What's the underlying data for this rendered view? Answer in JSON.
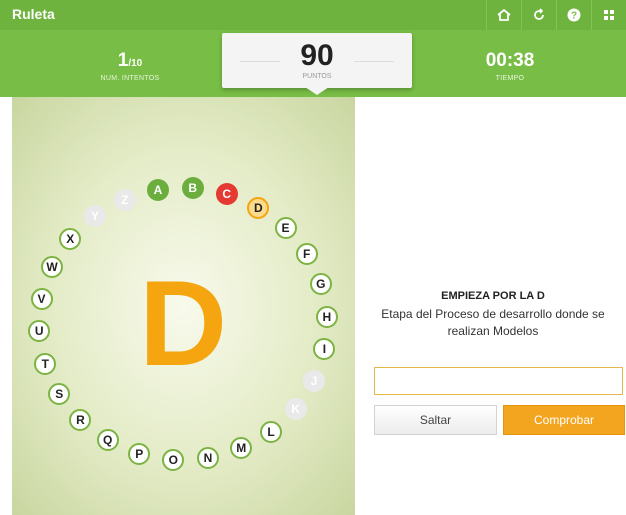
{
  "app": {
    "title": "Ruleta"
  },
  "toolbar": {
    "icons": [
      "home-icon",
      "restart-icon",
      "help-icon",
      "menu-icon"
    ]
  },
  "stats": {
    "attempts": {
      "value": "1",
      "total": "/10",
      "label": "NUM. INTENTOS"
    },
    "score": {
      "value": "90",
      "label": "PUNTOS"
    },
    "time": {
      "value": "00:38",
      "label": "TIEMPO"
    }
  },
  "game": {
    "current_letter": "D",
    "letters": [
      {
        "letter": "A",
        "status": "correct"
      },
      {
        "letter": "B",
        "status": "correct"
      },
      {
        "letter": "C",
        "status": "wrong"
      },
      {
        "letter": "D",
        "status": "current"
      },
      {
        "letter": "E",
        "status": "pending"
      },
      {
        "letter": "F",
        "status": "pending"
      },
      {
        "letter": "G",
        "status": "pending"
      },
      {
        "letter": "H",
        "status": "pending"
      },
      {
        "letter": "I",
        "status": "pending"
      },
      {
        "letter": "J",
        "status": "skipped"
      },
      {
        "letter": "K",
        "status": "skipped"
      },
      {
        "letter": "L",
        "status": "pending"
      },
      {
        "letter": "M",
        "status": "pending"
      },
      {
        "letter": "N",
        "status": "pending"
      },
      {
        "letter": "O",
        "status": "pending"
      },
      {
        "letter": "P",
        "status": "pending"
      },
      {
        "letter": "Q",
        "status": "pending"
      },
      {
        "letter": "R",
        "status": "pending"
      },
      {
        "letter": "S",
        "status": "pending"
      },
      {
        "letter": "T",
        "status": "pending"
      },
      {
        "letter": "U",
        "status": "pending"
      },
      {
        "letter": "V",
        "status": "pending"
      },
      {
        "letter": "W",
        "status": "pending"
      },
      {
        "letter": "X",
        "status": "pending"
      },
      {
        "letter": "Y",
        "status": "skipped"
      },
      {
        "letter": "Z",
        "status": "skipped"
      }
    ]
  },
  "question": {
    "title": "EMPIEZA POR LA D",
    "text": "Etapa del Proceso de desarrollo donde se realizan Modelos"
  },
  "answer": {
    "value": "",
    "placeholder": ""
  },
  "buttons": {
    "skip": "Saltar",
    "check": "Comprobar"
  },
  "colors": {
    "brand_green": "#78bd46",
    "correct": "#6cae3e",
    "wrong": "#e43a32",
    "current": "#f4a50f",
    "skipped": "#e9e9e9",
    "action": "#f4a520"
  }
}
